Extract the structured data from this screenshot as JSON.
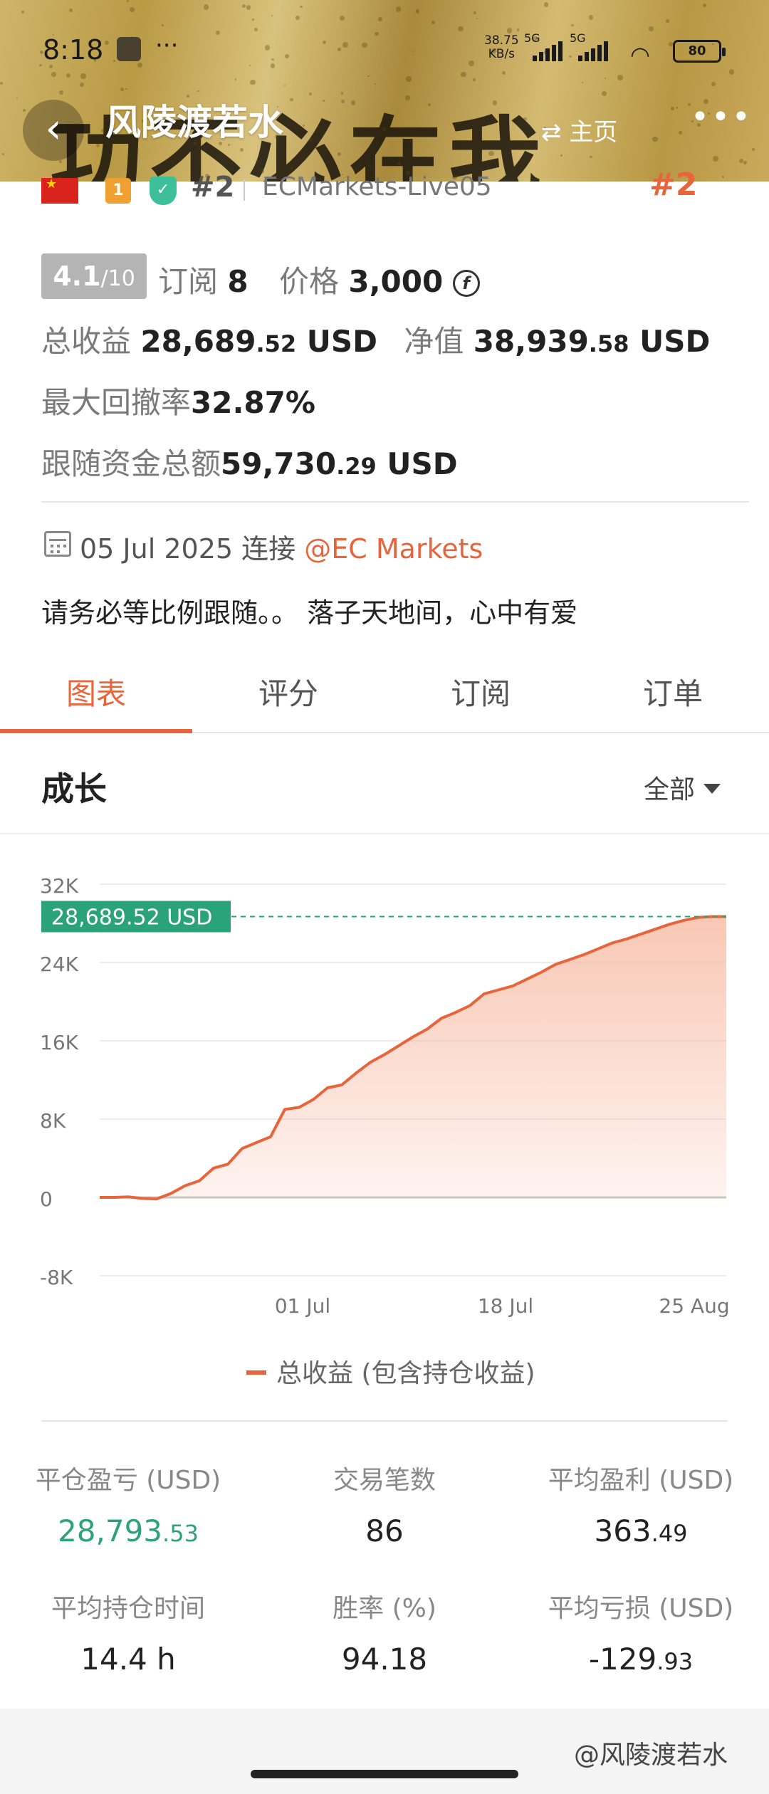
{
  "status_bar": {
    "time": "8:18",
    "dots": "···",
    "net_speed": "38.75",
    "net_unit": "KB/s",
    "sig1_label": "5G",
    "sig2_label": "5G",
    "battery": "80"
  },
  "header": {
    "title": "风陵渡若水",
    "home_label": "主页",
    "more": "•••",
    "calligraphy": "功不必在我"
  },
  "badges": {
    "level": "1",
    "rank": "#2",
    "account": "ECMarkets-Live05",
    "rank_right": "#2"
  },
  "stats": {
    "score": "4.1",
    "score_suffix": "/10",
    "subscribe_label": "订阅",
    "subscribe_count": "8",
    "price_label": "价格",
    "price_value": "3,000",
    "price_icon": "f",
    "total_profit_label": "总收益",
    "total_profit_int": "28,689",
    "total_profit_frac": ".52",
    "total_profit_unit": "USD",
    "equity_label": "净值",
    "equity_int": "38,939",
    "equity_frac": ".58",
    "equity_unit": "USD",
    "max_drawdown_label": "最大回撤率",
    "max_drawdown_value": "32.87%",
    "follow_funds_label": "跟随资金总额",
    "follow_funds_int": "59,730",
    "follow_funds_frac": ".29",
    "follow_funds_unit": "USD"
  },
  "connection": {
    "date_text": "05 Jul 2025 连接",
    "broker_link": "@EC Markets",
    "description": "请务必等比例跟随。。 落子天地间，心中有爱"
  },
  "tabs": [
    {
      "label": "图表",
      "active": true
    },
    {
      "label": "评分",
      "active": false
    },
    {
      "label": "订阅",
      "active": false
    },
    {
      "label": "订单",
      "active": false
    }
  ],
  "growth": {
    "title": "成长",
    "range": "全部"
  },
  "chart_data": {
    "type": "area",
    "series": [
      {
        "name": "总收益 (包含持仓收益)",
        "x": [
          "",
          "",
          "",
          "",
          "",
          "",
          "",
          "",
          "",
          "",
          "",
          "",
          "",
          "",
          "",
          "",
          "",
          "",
          "",
          "",
          "",
          "",
          "",
          "",
          "",
          "",
          "",
          "",
          "",
          "",
          "",
          "",
          "",
          "",
          "",
          "",
          "",
          "",
          "",
          "",
          "",
          "",
          "",
          "",
          ""
        ],
        "values": [
          0,
          0,
          50,
          -100,
          -150,
          400,
          1200,
          1700,
          3000,
          3400,
          5000,
          5600,
          6200,
          9000,
          9200,
          10000,
          11200,
          11500,
          12700,
          13800,
          14600,
          15500,
          16400,
          17200,
          18300,
          18900,
          19600,
          20800,
          21200,
          21600,
          22300,
          23000,
          23800,
          24300,
          24800,
          25400,
          26000,
          26400,
          26900,
          27400,
          27900,
          28300,
          28600,
          28689.52,
          28689.52
        ]
      }
    ],
    "current_label": "28,689.52 USD",
    "current_value": 28689.52,
    "ylim": [
      -8000,
      32000
    ],
    "yticks": [
      -8000,
      0,
      8000,
      16000,
      24000,
      32000
    ],
    "ytick_labels": [
      "-8K",
      "0",
      "8K",
      "16K",
      "24K",
      "32K"
    ],
    "xtick_labels": [
      "01 Jul",
      "18 Jul",
      "25 Aug"
    ],
    "legend": "总收益 (包含持仓收益)",
    "colors": {
      "line": "#e8643a",
      "fill": "#f7b49b",
      "label_bg": "#2ba37a",
      "ref_line": "#2ba37a"
    },
    "grid": true
  },
  "metrics": [
    {
      "label": "平仓盈亏 (USD)",
      "int": "28,793",
      "frac": ".53",
      "green": true
    },
    {
      "label": "交易笔数",
      "int": "86",
      "frac": "",
      "green": false
    },
    {
      "label": "平均盈利 (USD)",
      "int": "363",
      "frac": ".49",
      "green": false
    },
    {
      "label": "平均持仓时间",
      "int": "14.4 h",
      "frac": "",
      "green": false
    },
    {
      "label": "胜率 (%)",
      "int": "94.18",
      "frac": "",
      "green": false
    },
    {
      "label": "平均亏损 (USD)",
      "int": "-129",
      "frac": ".93",
      "green": false
    }
  ],
  "watermark": "@风陵渡若水",
  "colors": {
    "accent": "#e8643a",
    "positive": "#2ba37a"
  }
}
